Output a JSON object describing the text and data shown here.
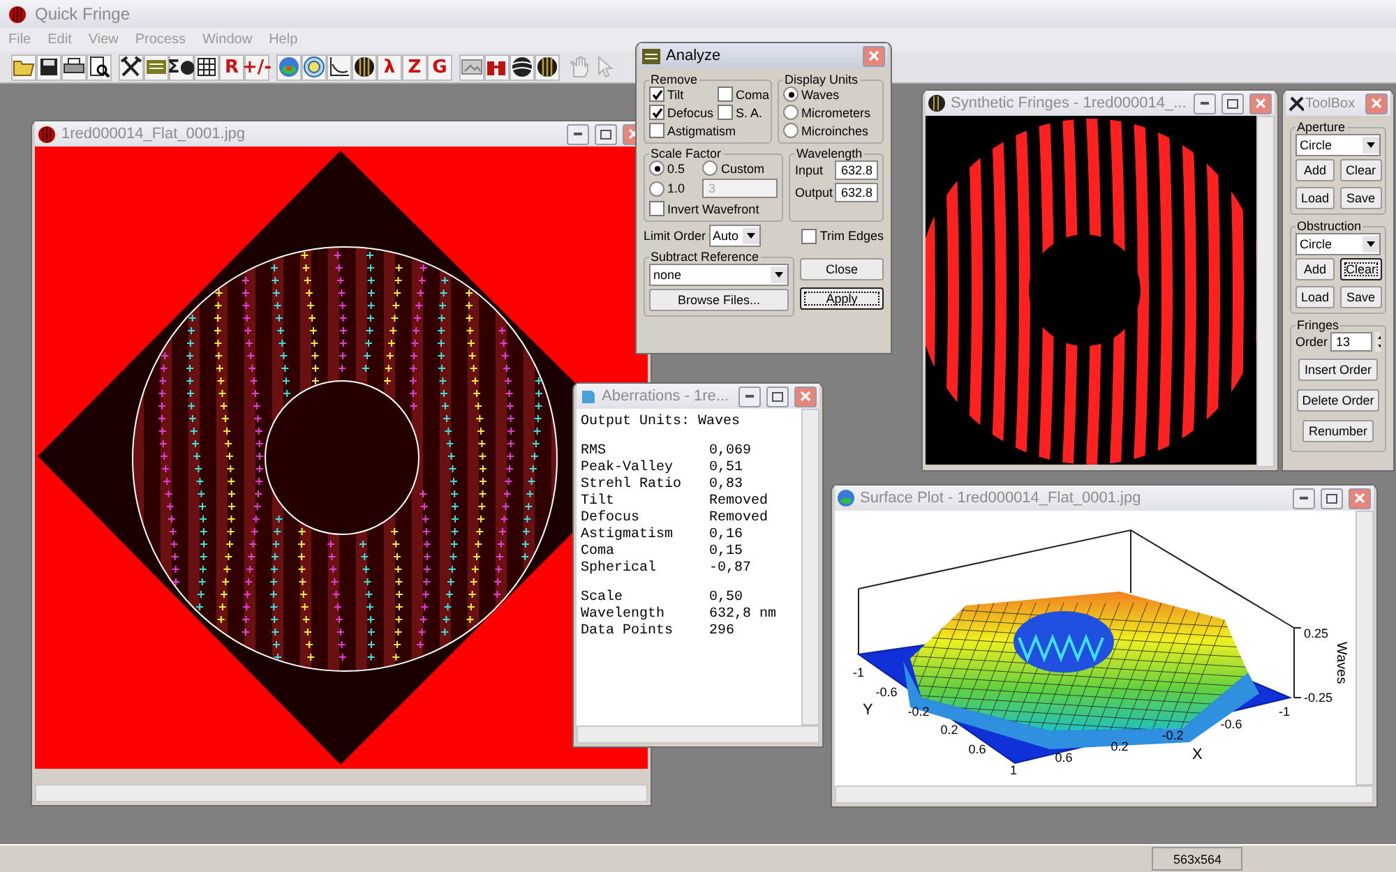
{
  "app": {
    "title": "Quick Fringe",
    "active": false
  },
  "menu": [
    "File",
    "Edit",
    "View",
    "Process",
    "Window",
    "Help"
  ],
  "toolbar": [
    [
      {
        "kind": "folder",
        "disabled": false
      },
      {
        "kind": "disk",
        "disabled": false
      },
      {
        "kind": "printer",
        "disabled": false
      },
      {
        "kind": "preview",
        "disabled": false
      }
    ],
    [
      {
        "kind": "tools",
        "disabled": false
      },
      {
        "kind": "calculator",
        "disabled": false
      },
      {
        "kind": "glyph",
        "text": "Σ●",
        "color": "#222222",
        "disabled": false
      },
      {
        "kind": "grid",
        "disabled": false
      },
      {
        "kind": "glyph",
        "text": "R",
        "color": "#cc1111",
        "disabled": false
      },
      {
        "kind": "glyph",
        "text": "+/-",
        "color": "#cc1111",
        "disabled": false
      }
    ],
    [
      {
        "kind": "surface",
        "disabled": false
      },
      {
        "kind": "contour",
        "disabled": false
      },
      {
        "kind": "graph",
        "disabled": false
      },
      {
        "kind": "sphere",
        "disabled": false
      },
      {
        "kind": "glyph",
        "text": "λ",
        "color": "#cc1111",
        "disabled": false
      },
      {
        "kind": "glyph",
        "text": "Z",
        "color": "#cc1111",
        "disabled": false
      },
      {
        "kind": "glyph",
        "text": "G",
        "color": "#cc1111",
        "disabled": false
      }
    ],
    [
      {
        "kind": "picture",
        "disabled": false
      },
      {
        "kind": "ratio",
        "disabled": false
      },
      {
        "kind": "wave",
        "disabled": false
      },
      {
        "kind": "sphere",
        "disabled": false
      }
    ],
    [
      {
        "kind": "hand",
        "disabled": true
      },
      {
        "kind": "pointer",
        "disabled": true
      }
    ]
  ],
  "image_window": {
    "title": "1red000014_Flat_0001.jpg",
    "active": false
  },
  "analyze": {
    "title": "Analyze",
    "active": true,
    "remove": {
      "legend": "Remove",
      "items": [
        {
          "label": "Tilt",
          "checked": true
        },
        {
          "label": "Coma",
          "checked": false
        },
        {
          "label": "Defocus",
          "checked": true
        },
        {
          "label": "S. A.",
          "checked": false
        },
        {
          "label": "Astigmatism",
          "checked": false
        }
      ]
    },
    "display_units": {
      "legend": "Display Units",
      "options": [
        {
          "label": "Waves",
          "selected": true
        },
        {
          "label": "Micrometers",
          "selected": false
        },
        {
          "label": "Microinches",
          "selected": false
        }
      ]
    },
    "scale_factor": {
      "legend": "Scale Factor",
      "options": [
        {
          "label": "0.5",
          "selected": true
        },
        {
          "label": "Custom",
          "selected": false
        },
        {
          "label": "1.0",
          "selected": false
        }
      ],
      "custom_value": "3",
      "custom_disabled": true,
      "invert_wavefront": {
        "label": "Invert Wavefront",
        "checked": false
      }
    },
    "wavelength": {
      "legend": "Wavelength",
      "input_label": "Input",
      "input_value": "632.8",
      "output_label": "Output",
      "output_value": "632.8"
    },
    "limit_order": {
      "label": "Limit Order",
      "value": "Auto"
    },
    "trim_edges": {
      "label": "Trim Edges",
      "checked": false
    },
    "subtract_reference": {
      "legend": "Subtract Reference",
      "value": "none",
      "browse": "Browse Files..."
    },
    "buttons": [
      {
        "label": "Close",
        "focused": false
      },
      {
        "label": "Apply",
        "focused": true
      }
    ]
  },
  "synthetic_window": {
    "title": "Synthetic Fringes - 1red000014_...",
    "active": false
  },
  "toolbox": {
    "title": "ToolBox",
    "active": false,
    "aperture": {
      "legend": "Aperture",
      "value": "Circle",
      "buttons": [
        {
          "label": "Add",
          "focused": false
        },
        {
          "label": "Clear",
          "focused": false
        },
        {
          "label": "Load",
          "focused": false
        },
        {
          "label": "Save",
          "focused": false
        }
      ]
    },
    "obstruction": {
      "legend": "Obstruction",
      "value": "Circle",
      "buttons": [
        {
          "label": "Add",
          "focused": false
        },
        {
          "label": "Clear",
          "focused": true
        },
        {
          "label": "Load",
          "focused": false
        },
        {
          "label": "Save",
          "focused": false
        }
      ]
    },
    "fringes": {
      "legend": "Fringes",
      "order_label": "Order",
      "order_value": "13",
      "buttons": [
        {
          "label": "Insert Order",
          "focused": false
        },
        {
          "label": "Delete Order",
          "focused": false
        },
        {
          "label": "Renumber",
          "focused": false
        }
      ]
    }
  },
  "aberrations": {
    "title": "Aberrations - 1re...",
    "active": false,
    "header": "Output Units: Waves",
    "sections": [
      [
        {
          "label": "RMS",
          "value": "0,069"
        },
        {
          "label": "Peak-Valley",
          "value": "0,51"
        },
        {
          "label": "Strehl Ratio",
          "value": "0,83"
        },
        {
          "label": "Tilt",
          "value": "Removed"
        },
        {
          "label": "Defocus",
          "value": "Removed"
        },
        {
          "label": "Astigmatism",
          "value": "0,16"
        },
        {
          "label": "Coma",
          "value": "0,15"
        },
        {
          "label": "Spherical",
          "value": "-0,87"
        }
      ],
      [
        {
          "label": "Scale",
          "value": "0,50"
        },
        {
          "label": "Wavelength",
          "value": "632,8 nm"
        },
        {
          "label": "Data Points",
          "value": "296"
        }
      ]
    ]
  },
  "surface_window": {
    "title": "Surface Plot - 1red000014_Flat_0001.jpg",
    "active": false,
    "y_label": "Y",
    "y_ticks": [
      "-1",
      "-0.6",
      "-0.2",
      "0.2",
      "0.6",
      "1"
    ],
    "x_label": "X",
    "x_ticks": [
      "0.6",
      "0.2",
      "-0.2",
      "-0.6",
      "-1"
    ],
    "z_label": "Waves",
    "z_ticks": [
      "0.25",
      "-0.25"
    ]
  },
  "status_bar": {
    "dimensions": "563x564"
  }
}
